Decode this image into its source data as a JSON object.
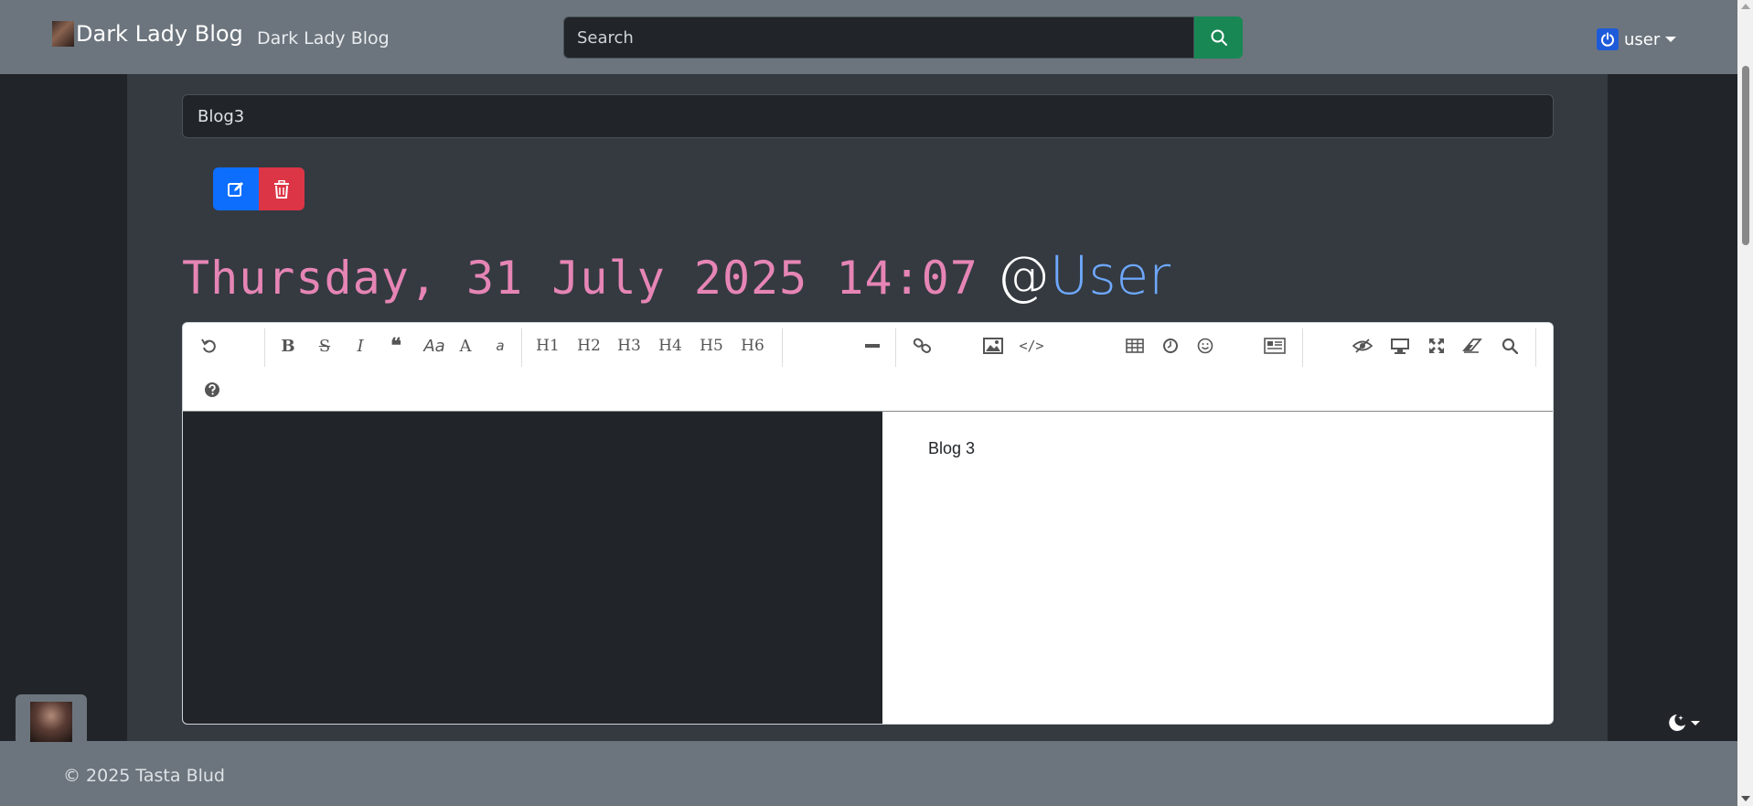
{
  "navbar": {
    "brand": "Dark Lady Blog",
    "nav_link": "Dark Lady Blog",
    "search_placeholder": "Search",
    "user": "user"
  },
  "post": {
    "title_value": "Blog3",
    "date": "Thursday, 31 July 2025 14:07",
    "at": "@",
    "author": "User"
  },
  "toolbar": {
    "heading_buttons": [
      "H1",
      "H2",
      "H3",
      "H4",
      "H5",
      "H6"
    ],
    "icons": [
      "undo-icon",
      "bold-icon",
      "strikethrough-icon",
      "italic-icon",
      "quote-icon",
      "uppercase-icon",
      "font-size-icon",
      "lowercase-icon",
      "hr-icon",
      "link-icon",
      "image-icon",
      "code-icon",
      "table-icon",
      "datetime-icon",
      "emoji-icon",
      "html-entities-icon",
      "hide-preview-icon",
      "watch-icon",
      "fullscreen-icon",
      "clear-icon",
      "search-icon",
      "help-icon"
    ]
  },
  "editor": {
    "preview_text": "Blog 3"
  },
  "footer": {
    "copyright": "© 2025 Tasta Blud"
  },
  "colors": {
    "navbar_bg": "#6c757d",
    "page_bg": "#212529",
    "main_bg": "#343a40",
    "date_pink": "#e685b5",
    "author_blue": "#6ea8fe",
    "search_btn": "#198754",
    "edit_btn": "#0d6efd",
    "delete_btn": "#dc3545"
  }
}
